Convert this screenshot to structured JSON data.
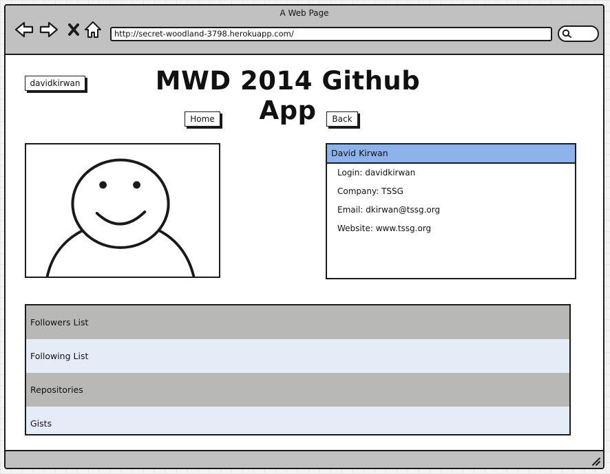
{
  "window": {
    "title": "A Web Page"
  },
  "toolbar": {
    "url": "http://secret-woodland-3798.herokuapp.com/",
    "icons": [
      "back-arrow-icon",
      "forward-arrow-icon",
      "close-x-icon",
      "home-icon",
      "search-icon"
    ]
  },
  "header": {
    "username": "davidkirwan",
    "title": "MWD 2014 Github App"
  },
  "nav": {
    "home_label": "Home",
    "back_label": "Back"
  },
  "profile": {
    "name": "David Kirwan",
    "rows": [
      "Login: davidkirwan",
      "Company: TSSG",
      "Email: dkirwan@tssg.org",
      "Website: www.tssg.org"
    ]
  },
  "menu": {
    "items": [
      "Followers List",
      "Following List",
      "Repositories",
      "Gists"
    ]
  },
  "colors": {
    "chrome": "#c1c1c1",
    "selected_header": "#8db3ea",
    "menu_dark": "#b8b8b6",
    "menu_light": "#e5ecf8"
  }
}
